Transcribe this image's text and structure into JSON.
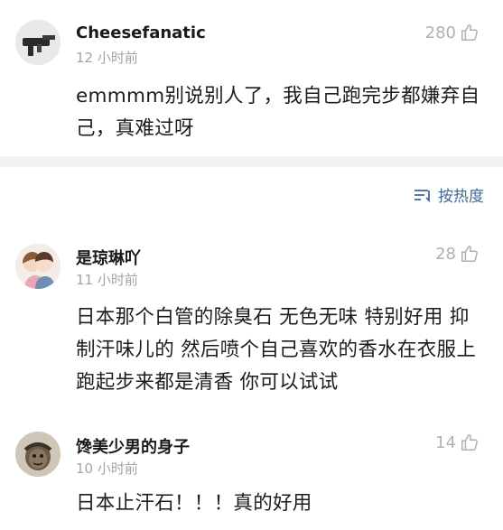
{
  "comments": [
    {
      "username": "Cheesefanatic",
      "time": "12 小时前",
      "likes": "280",
      "text": "emmmm别说别人了，我自己跑完步都嫌弃自己，真难过呀",
      "avatar_icon": "gun-photo-avatar"
    },
    {
      "username": "是琼琳吖",
      "time": "11 小时前",
      "likes": "28",
      "text": "日本那个白管的除臭石 无色无味 特别好用 抑制汗味儿的 然后喷个自己喜欢的香水在衣服上 跑起步来都是清香 你可以试试",
      "avatar_icon": "couple-cartoon-avatar"
    },
    {
      "username": "馋美少男的身子",
      "time": "10 小时前",
      "likes": "14",
      "text": "日本止汗石！！！真的好用",
      "avatar_icon": "meme-face-avatar"
    }
  ],
  "sort": {
    "label": "按热度",
    "icon": "sort-lines-icon"
  },
  "colors": {
    "link_blue": "#3f6a9a",
    "meta_gray": "#a4a4a4",
    "divider": "#f2f2f2"
  }
}
